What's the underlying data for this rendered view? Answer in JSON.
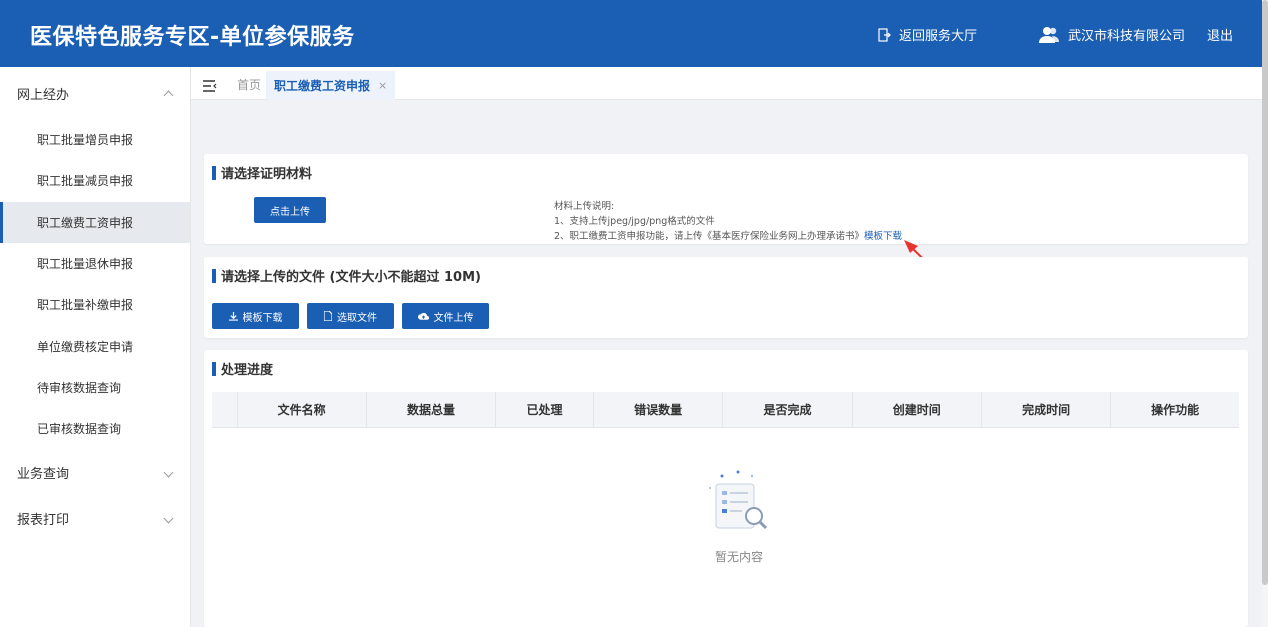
{
  "header": {
    "app_title": "医保特色服务专区-单位参保服务",
    "return_label": "返回服务大厅",
    "company_name": "武汉市科技有限公司",
    "logout_label": "退出",
    "brand_color": "#1b5fb5"
  },
  "sidebar": {
    "group_online": "网上经办",
    "items": [
      {
        "label": "职工批量增员申报"
      },
      {
        "label": "职工批量减员申报"
      },
      {
        "label": "职工缴费工资申报"
      },
      {
        "label": "职工批量退休申报"
      },
      {
        "label": "职工批量补缴申报"
      },
      {
        "label": "单位缴费核定申请"
      },
      {
        "label": "待审核数据查询"
      },
      {
        "label": "已审核数据查询"
      }
    ],
    "active_index": 2,
    "group_business": "业务查询",
    "group_report": "报表打印"
  },
  "tabs": {
    "home": "首页",
    "active": "职工缴费工资申报",
    "close_glyph": "×"
  },
  "proof_section": {
    "title": "请选择证明材料",
    "upload_button": "点击上传",
    "note_heading": "材料上传说明:",
    "note_1": "1、支持上传jpeg/jpg/png格式的文件",
    "note_2": "2、职工缴费工资申报功能，请上传《基本医疗保险业务网上办理承诺书》",
    "template_link": "模板下载"
  },
  "file_section": {
    "title": "请选择上传的文件 (文件大小不能超过 10M)",
    "btn_template": "模板下载",
    "btn_choose": "选取文件",
    "btn_upload": "文件上传"
  },
  "progress_section": {
    "title": "处理进度",
    "columns": [
      "",
      "文件名称",
      "数据总量",
      "已处理",
      "错误数量",
      "是否完成",
      "创建时间",
      "完成时间",
      "操作功能"
    ],
    "empty_text": "暂无内容"
  }
}
